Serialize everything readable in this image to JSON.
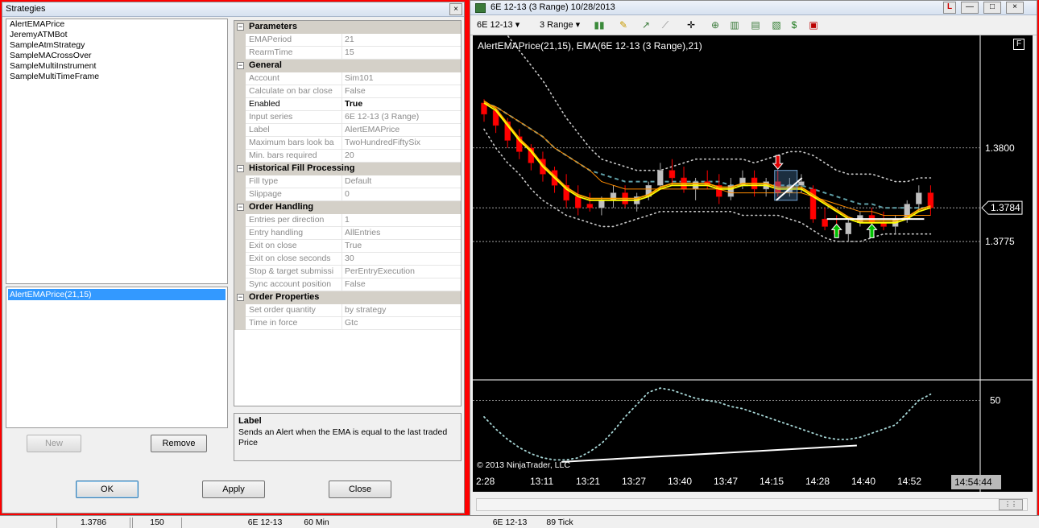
{
  "dialog": {
    "title": "Strategies",
    "close_glyph": "×",
    "strategies": [
      "AlertEMAPrice",
      "JeremyATMBot",
      "SampleAtmStrategy",
      "SampleMACrossOver",
      "SampleMultiInstrument",
      "SampleMultiTimeFrame"
    ],
    "active_strategies": [
      "AlertEMAPrice(21,15)"
    ],
    "buttons": {
      "new": "New",
      "remove": "Remove",
      "ok": "OK",
      "apply": "Apply",
      "close": "Close"
    },
    "properties": [
      {
        "category": "Parameters",
        "rows": [
          {
            "name": "EMAPeriod",
            "value": "21",
            "enabled": false
          },
          {
            "name": "RearmTime",
            "value": "15",
            "enabled": false
          }
        ]
      },
      {
        "category": "General",
        "rows": [
          {
            "name": "Account",
            "value": "Sim101",
            "enabled": false
          },
          {
            "name": "Calculate on bar close",
            "value": "False",
            "enabled": false
          },
          {
            "name": "Enabled",
            "value": "True",
            "enabled": true
          },
          {
            "name": "Input series",
            "value": "6E 12-13 (3 Range)",
            "enabled": false
          },
          {
            "name": "Label",
            "value": "AlertEMAPrice",
            "enabled": false
          },
          {
            "name": "Maximum bars look ba",
            "value": "TwoHundredFiftySix",
            "enabled": false
          },
          {
            "name": "Min. bars required",
            "value": "20",
            "enabled": false
          }
        ]
      },
      {
        "category": "Historical Fill Processing",
        "rows": [
          {
            "name": "Fill type",
            "value": "Default",
            "enabled": false
          },
          {
            "name": "Slippage",
            "value": "0",
            "enabled": false
          }
        ]
      },
      {
        "category": "Order Handling",
        "rows": [
          {
            "name": "Entries per direction",
            "value": "1",
            "enabled": false
          },
          {
            "name": "Entry handling",
            "value": "AllEntries",
            "enabled": false
          },
          {
            "name": "Exit on close",
            "value": "True",
            "enabled": false
          },
          {
            "name": "Exit on close seconds",
            "value": "30",
            "enabled": false
          },
          {
            "name": "Stop & target submissi",
            "value": "PerEntryExecution",
            "enabled": false
          },
          {
            "name": "Sync account position",
            "value": "False",
            "enabled": false
          }
        ]
      },
      {
        "category": "Order Properties",
        "rows": [
          {
            "name": "Set order quantity",
            "value": "by strategy",
            "enabled": false
          },
          {
            "name": "Time in force",
            "value": "Gtc",
            "enabled": false
          }
        ]
      }
    ],
    "description": {
      "heading": "Label",
      "text": "Sends an Alert when the EMA is equal to the last traded Price"
    }
  },
  "chart_window": {
    "title": "6E 12-13 (3 Range)  10/28/2013",
    "window_buttons": {
      "l": "L",
      "min": "—",
      "max": "□",
      "close": "×"
    },
    "toolbar": {
      "instrument": "6E 12-13",
      "period": "3 Range"
    },
    "f_button": "F",
    "indicator_label": "AlertEMAPrice(21,15), EMA(6E 12-13 (3 Range),21)",
    "copyright": "© 2013 NinjaTrader, LLC",
    "current_price": "1.3784",
    "current_time": "14:54:44",
    "colors": {
      "background": "#000000",
      "up": "#c0c0c0",
      "down": "#ff0000",
      "ema": "#ffff00",
      "ema_fast": "#ffa500",
      "ema_slow": "#ff8c00",
      "bands": "#c8c8c8",
      "mid": "#5fa0a8",
      "oscillator": "#a8d8d8"
    }
  },
  "chart_data": {
    "type": "candlestick",
    "price_axis_labels": [
      "1.3800",
      "1.3775"
    ],
    "price_last": 1.3784,
    "oscillator_axis_label": "50",
    "time_labels": [
      "2:28",
      "13:11",
      "13:21",
      "13:27",
      "13:40",
      "13:47",
      "14:15",
      "14:28",
      "14:40",
      "14:52"
    ],
    "bars": [
      [
        1.3812,
        1.3813,
        1.3807,
        1.3809
      ],
      [
        1.381,
        1.3811,
        1.3804,
        1.3806
      ],
      [
        1.3807,
        1.3808,
        1.38,
        1.3802
      ],
      [
        1.3803,
        1.3805,
        1.3797,
        1.3799
      ],
      [
        1.38,
        1.3801,
        1.3794,
        1.3796
      ],
      [
        1.3797,
        1.3799,
        1.3791,
        1.3793
      ],
      [
        1.3794,
        1.3795,
        1.3788,
        1.379
      ],
      [
        1.379,
        1.3793,
        1.3784,
        1.3786
      ],
      [
        1.3787,
        1.379,
        1.3782,
        1.3784
      ],
      [
        1.3785,
        1.3788,
        1.3783,
        1.3784
      ],
      [
        1.3784,
        1.3787,
        1.3782,
        1.3786
      ],
      [
        1.3786,
        1.379,
        1.3784,
        1.3788
      ],
      [
        1.3788,
        1.379,
        1.3784,
        1.3785
      ],
      [
        1.3785,
        1.3788,
        1.3783,
        1.3787
      ],
      [
        1.3787,
        1.3791,
        1.3786,
        1.379
      ],
      [
        1.379,
        1.3796,
        1.3789,
        1.3794
      ],
      [
        1.3794,
        1.3797,
        1.379,
        1.3792
      ],
      [
        1.3792,
        1.3795,
        1.3788,
        1.3789
      ],
      [
        1.3789,
        1.3792,
        1.3786,
        1.3791
      ],
      [
        1.3791,
        1.3794,
        1.3789,
        1.379
      ],
      [
        1.379,
        1.3793,
        1.3785,
        1.3787
      ],
      [
        1.3787,
        1.3792,
        1.3786,
        1.379
      ],
      [
        1.379,
        1.3794,
        1.3789,
        1.3792
      ],
      [
        1.3792,
        1.3794,
        1.3787,
        1.3789
      ],
      [
        1.3789,
        1.3792,
        1.3787,
        1.3791
      ],
      [
        1.3791,
        1.3794,
        1.3787,
        1.3788
      ],
      [
        1.3788,
        1.3792,
        1.3787,
        1.379
      ],
      [
        1.379,
        1.3793,
        1.3788,
        1.3791
      ],
      [
        1.3789,
        1.379,
        1.378,
        1.3781
      ],
      [
        1.3781,
        1.3784,
        1.3778,
        1.3779
      ],
      [
        1.3779,
        1.3782,
        1.3776,
        1.3777
      ],
      [
        1.3777,
        1.3781,
        1.3775,
        1.378
      ],
      [
        1.378,
        1.3783,
        1.3779,
        1.3782
      ],
      [
        1.3782,
        1.3784,
        1.3778,
        1.378
      ],
      [
        1.378,
        1.3783,
        1.3778,
        1.3779
      ],
      [
        1.3779,
        1.3782,
        1.3777,
        1.3781
      ],
      [
        1.3781,
        1.3786,
        1.378,
        1.3785
      ],
      [
        1.3785,
        1.379,
        1.3783,
        1.3788
      ],
      [
        1.3788,
        1.379,
        1.3782,
        1.3784
      ]
    ],
    "ema": [
      1.3812,
      1.381,
      1.3806,
      1.3802,
      1.3799,
      1.3795,
      1.3792,
      1.3789,
      1.3787,
      1.3786,
      1.3786,
      1.3786,
      1.3786,
      1.3786,
      1.3787,
      1.3789,
      1.379,
      1.379,
      1.379,
      1.379,
      1.3789,
      1.3789,
      1.379,
      1.379,
      1.379,
      1.3789,
      1.3789,
      1.3789,
      1.3787,
      1.3785,
      1.3783,
      1.3781,
      1.378,
      1.378,
      1.378,
      1.378,
      1.3781,
      1.3783,
      1.3784
    ],
    "ema_slow": [
      1.3812,
      1.3811,
      1.3809,
      1.3807,
      1.3805,
      1.3803,
      1.38,
      1.3798,
      1.3796,
      1.3794,
      1.3793,
      1.3792,
      1.3791,
      1.3791,
      1.3791,
      1.3791,
      1.3791,
      1.3791,
      1.3791,
      1.3791,
      1.3791,
      1.379,
      1.379,
      1.379,
      1.379,
      1.379,
      1.379,
      1.379,
      1.3789,
      1.3788,
      1.3787,
      1.3786,
      1.3785,
      1.3785,
      1.3784,
      1.3784,
      1.3784,
      1.3784,
      1.3784
    ],
    "upper_band": [
      1.3835,
      1.3833,
      1.383,
      1.3826,
      1.3822,
      1.3818,
      1.3813,
      1.3808,
      1.3804,
      1.38,
      1.3797,
      1.3796,
      1.3795,
      1.3794,
      1.3794,
      1.3794,
      1.3795,
      1.3796,
      1.3797,
      1.3797,
      1.3797,
      1.3797,
      1.3797,
      1.3796,
      1.3797,
      1.3798,
      1.3799,
      1.3799,
      1.3798,
      1.3796,
      1.3794,
      1.3793,
      1.3793,
      1.3793,
      1.3792,
      1.3791,
      1.3791,
      1.3792,
      1.3792
    ],
    "lower_band": [
      1.3805,
      1.38,
      1.3796,
      1.3793,
      1.3789,
      1.3786,
      1.3784,
      1.3782,
      1.3781,
      1.378,
      1.3779,
      1.3779,
      1.378,
      1.3781,
      1.3782,
      1.3783,
      1.3783,
      1.3783,
      1.3783,
      1.3783,
      1.3783,
      1.3783,
      1.3782,
      1.3782,
      1.3782,
      1.3782,
      1.3781,
      1.378,
      1.3778,
      1.3776,
      1.3775,
      1.3775,
      1.3775,
      1.3776,
      1.3777,
      1.3777,
      1.3777,
      1.3777,
      1.3777
    ],
    "oscillator": [
      42,
      36,
      31,
      27,
      24,
      22,
      21,
      21,
      22,
      25,
      29,
      35,
      42,
      48,
      54,
      56,
      55,
      53,
      51,
      50,
      49,
      47,
      46,
      44,
      42,
      40,
      38,
      36,
      34,
      32,
      31,
      31,
      32,
      34,
      36,
      38,
      44,
      50,
      53
    ],
    "signals": {
      "sell_arrows_at_bar": [
        25
      ],
      "buy_arrows_at_bar": [
        30,
        33
      ]
    }
  },
  "bottom_strip": {
    "cell1": "1.3786",
    "cell2": "150",
    "instrument": "6E 12-13",
    "period": "60 Min",
    "instrument2": "6E 12-13",
    "period2": "89 Tick"
  }
}
